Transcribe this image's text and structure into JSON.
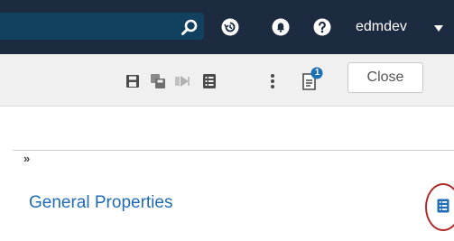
{
  "banner": {
    "user_name": "edmdev",
    "icons": [
      "search-icon",
      "history-icon",
      "notifications-icon",
      "help-icon",
      "chevron-down-icon"
    ]
  },
  "toolbar": {
    "icons": [
      "save-icon",
      "save-as-icon",
      "run-icon",
      "properties-icon",
      "more-actions-icon",
      "notes-icon"
    ],
    "notification_badge": "1",
    "close_label": "Close"
  },
  "panel": {
    "toggle_label": "»",
    "section_title": "General Properties",
    "section_icon": "properties-icon"
  },
  "colors": {
    "banner": "#1d2b40",
    "search_field": "#12405f",
    "link_blue": "#1f6cb5",
    "badge_blue": "#1b6fb5",
    "highlight_red": "#b22a2a"
  }
}
